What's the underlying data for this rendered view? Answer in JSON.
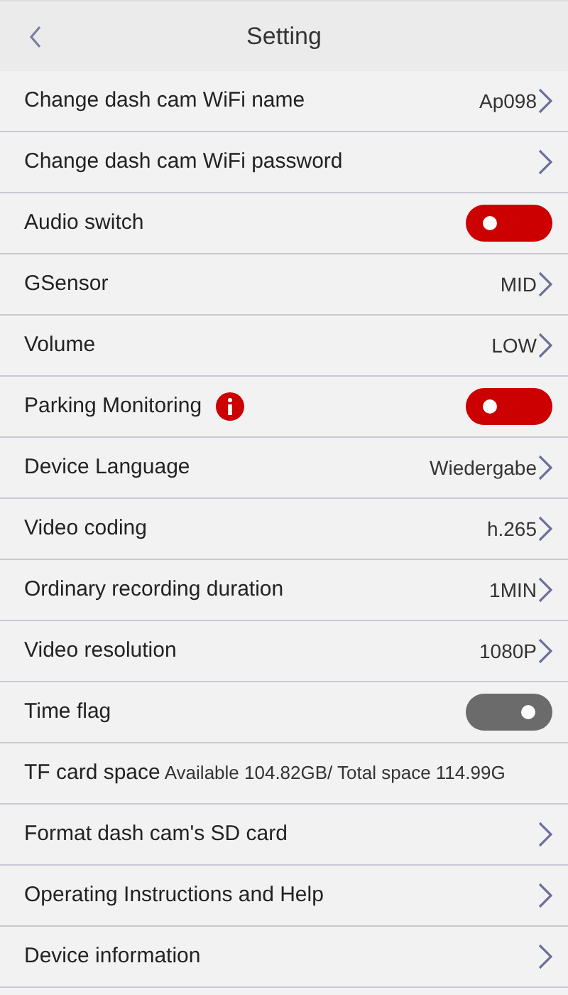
{
  "header": {
    "title": "Setting"
  },
  "rows": [
    {
      "kind": "link",
      "label": "Change dash cam WiFi name",
      "value": "Ap098"
    },
    {
      "kind": "link",
      "label": "Change dash cam WiFi password"
    },
    {
      "kind": "toggle",
      "label": "Audio switch",
      "on": true
    },
    {
      "kind": "link",
      "label": "GSensor",
      "value": "MID"
    },
    {
      "kind": "link",
      "label": "Volume",
      "value": "LOW"
    },
    {
      "kind": "toggle",
      "label": "Parking Monitoring",
      "on": true,
      "info": true
    },
    {
      "kind": "link",
      "label": "Device Language",
      "value": "Wiedergabe"
    },
    {
      "kind": "link",
      "label": "Video coding",
      "value": "h.265"
    },
    {
      "kind": "link",
      "label": "Ordinary recording duration",
      "value": "1MIN"
    },
    {
      "kind": "link",
      "label": "Video resolution",
      "value": "1080P"
    },
    {
      "kind": "toggle",
      "label": "Time flag",
      "on": false
    },
    {
      "kind": "text",
      "label": "TF card space",
      "value": "Available 104.82GB/ Total space 114.99G"
    },
    {
      "kind": "link",
      "label": "Format dash cam's SD card"
    },
    {
      "kind": "link",
      "label": "Operating Instructions and Help"
    },
    {
      "kind": "link",
      "label": "Device information"
    }
  ]
}
